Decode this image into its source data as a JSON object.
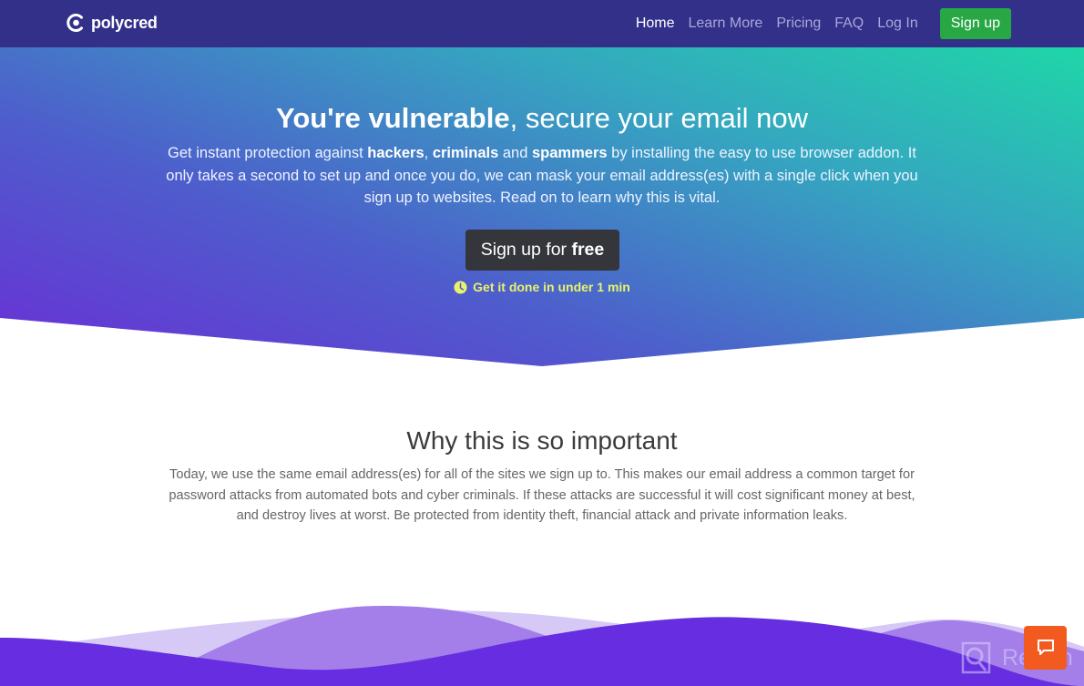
{
  "navbar": {
    "brand": "polycred",
    "logo_icon": "polycred-logo-icon",
    "links": [
      {
        "label": "Home",
        "active": true
      },
      {
        "label": "Learn More",
        "active": false
      },
      {
        "label": "Pricing",
        "active": false
      },
      {
        "label": "FAQ",
        "active": false
      },
      {
        "label": "Log In",
        "active": false
      }
    ],
    "signup_label": "Sign up"
  },
  "hero": {
    "title_bold": "You're vulnerable",
    "title_rest": ", secure your email now",
    "desc_parts": {
      "p1": "Get instant protection against ",
      "b1": "hackers",
      "p2": ", ",
      "b2": "criminals",
      "p3": " and ",
      "b3": "spammers",
      "p4": " by installing the easy to use browser addon. It only takes a second to set up and once you do, we can mask your email address(es) with a single click when you sign up to websites. Read on to learn why this is vital."
    },
    "cta_prefix": "Sign up for ",
    "cta_bold": "free",
    "note_icon": "clock-icon",
    "note": "Get it done in under 1 min"
  },
  "importance": {
    "title": "Why this is so important",
    "text": "Today, we use the same email address(es) for all of the sites we sign up to. This makes our email address a common target for password attacks from automated bots and cyber criminals. If these attacks are successful it will cost significant money at best, and destroy lives at worst. Be protected from identity theft, financial attack and private information leaks."
  },
  "chat": {
    "icon": "chat-bubble-icon"
  },
  "watermark": {
    "text": "Revain"
  },
  "colors": {
    "navbar": "#33308a",
    "signup_green": "#28a745",
    "gradient_start": "#1fd6a8",
    "gradient_end": "#6a2fd6",
    "cta_dark": "#34363b",
    "note_yellow": "#e8f26a",
    "wave_purple": "#662ee0",
    "chat_orange": "#f35a20"
  }
}
